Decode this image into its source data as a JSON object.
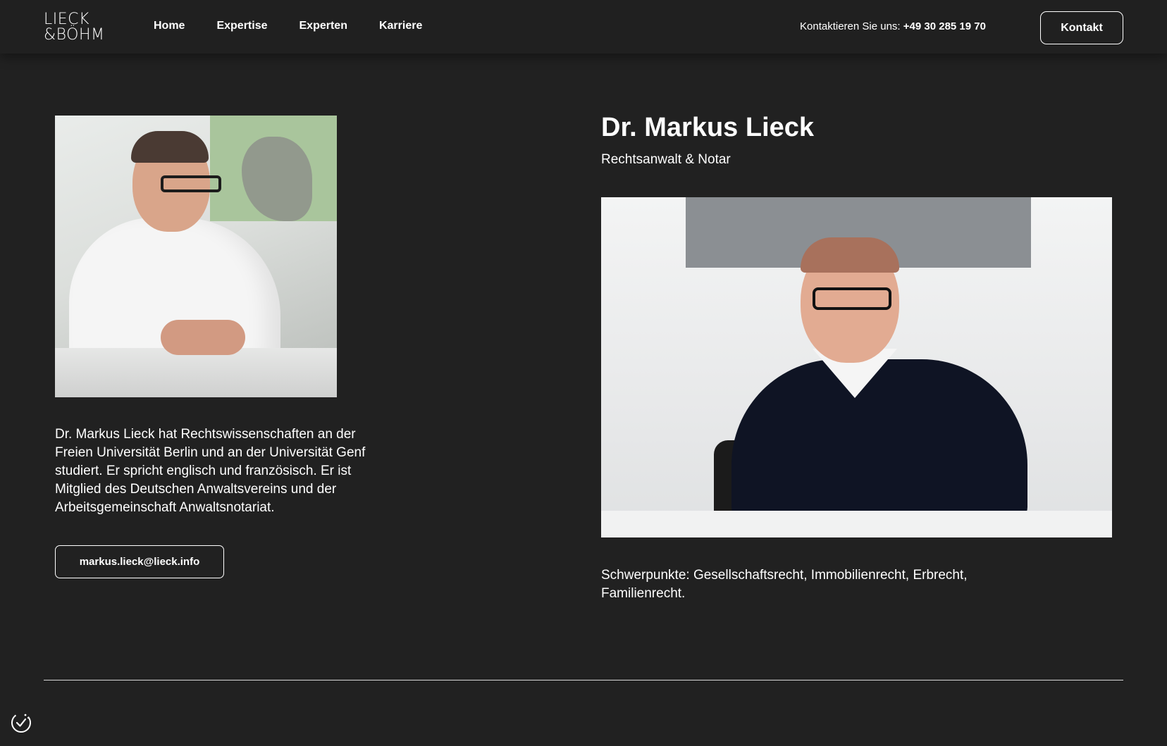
{
  "header": {
    "logo_line1": "LIECK",
    "logo_line2": "&BÖHM",
    "nav": [
      "Home",
      "Expertise",
      "Experten",
      "Karriere"
    ],
    "contact_label": "Kontaktieren Sie uns:",
    "contact_phone": "+49 30 285 19 70",
    "contact_button": "Kontakt"
  },
  "profile": {
    "name": "Dr. Markus Lieck",
    "role": "Rechtsanwalt & Notar",
    "bio": "Dr. Markus Lieck hat Rechtswissenschaften an der Freien Universität Berlin und an der Universität Genf studiert. Er spricht englisch und französisch. Er ist Mitglied des Deutschen Anwaltsvereins und der Arbeitsgemeinschaft Anwaltsnotariat.",
    "email": "markus.lieck@lieck.info",
    "focus": "Schwerpunkte: Gesellschaftsrecht, Immobilienrecht, Erbrecht, Familienrecht."
  },
  "colors": {
    "background": "#212121",
    "text": "#ffffff",
    "divider": "#d8d8d8"
  },
  "icons": {
    "cookie": "cookie-settings-icon"
  }
}
